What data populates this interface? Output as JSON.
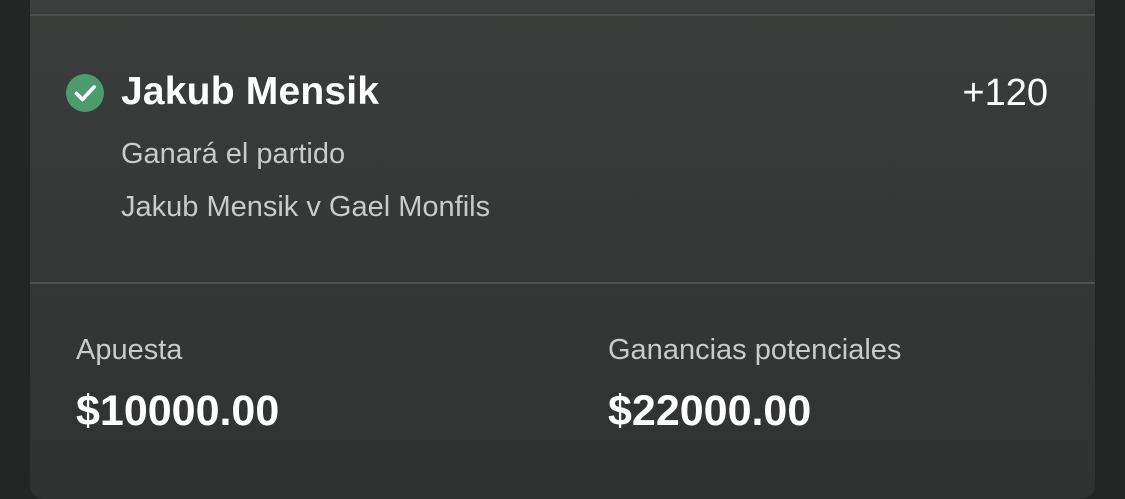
{
  "selection": {
    "name": "Jakub Mensik",
    "odds": "+120",
    "market": "Ganará el partido",
    "event": "Jakub Mensik v Gael Monfils",
    "status_icon": "check-circle-icon",
    "status_color": "#4e9b6f"
  },
  "summary": {
    "stake_label": "Apuesta",
    "stake_value": "$10000.00",
    "payout_label": "Ganancias potenciales",
    "payout_value": "$22000.00"
  },
  "colors": {
    "background": "#242625",
    "card": "#363938",
    "divider": "#4c4f4d",
    "primary_text": "#ffffff",
    "secondary_text": "#c9cbc9"
  }
}
